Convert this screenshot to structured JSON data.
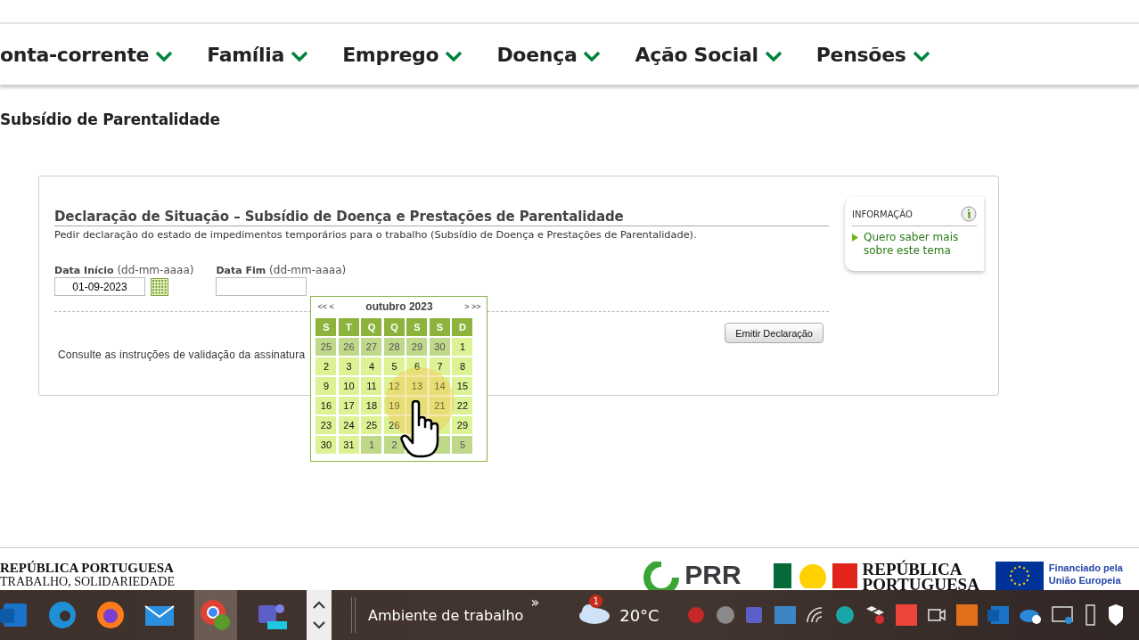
{
  "nav": [
    {
      "label": "onta-corrente"
    },
    {
      "label": "Família"
    },
    {
      "label": "Emprego"
    },
    {
      "label": "Doença"
    },
    {
      "label": "Ação Social"
    },
    {
      "label": "Pensões"
    }
  ],
  "page_title": "Subsídio de Parentalidade",
  "form": {
    "title": "Declaração de Situação – Subsídio de Doença e Prestações de Parentalidade",
    "description": "Pedir declaração do estado de impedimentos temporários para o trabalho (Subsídio de Doença e Prestações de Parentalidade).",
    "start": {
      "label": "Data Início",
      "hint": "(dd-mm-aaaa)",
      "value": "01-09-2023"
    },
    "end": {
      "label": "Data Fim",
      "hint": "(dd-mm-aaaa)"
    },
    "button": "Emitir Declaração",
    "note": "Consulte as instruções de validação da assinatura"
  },
  "info": {
    "title": "INFORMAÇÃO",
    "link": "Quero saber mais sobre este tema"
  },
  "calendar": {
    "prev_year": "<<",
    "prev_month": "<",
    "month": "outubro 2023",
    "next_month": ">",
    "next_year": ">>",
    "weekdays": [
      "S",
      "T",
      "Q",
      "Q",
      "S",
      "S",
      "D"
    ],
    "days": [
      {
        "day": "25",
        "muted": true
      },
      {
        "day": "26",
        "muted": true
      },
      {
        "day": "27",
        "muted": true
      },
      {
        "day": "28",
        "muted": true
      },
      {
        "day": "29",
        "muted": true
      },
      {
        "day": "30",
        "muted": true
      },
      {
        "day": "1",
        "muted": false
      },
      {
        "day": "2",
        "muted": false
      },
      {
        "day": "3",
        "muted": false
      },
      {
        "day": "4",
        "muted": false
      },
      {
        "day": "5",
        "muted": false
      },
      {
        "day": "6",
        "muted": false
      },
      {
        "day": "7",
        "muted": false
      },
      {
        "day": "8",
        "muted": false
      },
      {
        "day": "9",
        "muted": false
      },
      {
        "day": "10",
        "muted": false
      },
      {
        "day": "11",
        "muted": false
      },
      {
        "day": "12",
        "muted": false
      },
      {
        "day": "13",
        "muted": false
      },
      {
        "day": "14",
        "muted": false
      },
      {
        "day": "15",
        "muted": false
      },
      {
        "day": "16",
        "muted": false
      },
      {
        "day": "17",
        "muted": false
      },
      {
        "day": "18",
        "muted": false
      },
      {
        "day": "19",
        "muted": false
      },
      {
        "muted": false
      },
      {
        "day": "21",
        "muted": false
      },
      {
        "day": "22",
        "muted": false
      },
      {
        "day": "23",
        "muted": false
      },
      {
        "day": "24",
        "muted": false
      },
      {
        "day": "25",
        "muted": false
      },
      {
        "day": "26",
        "muted": false
      },
      {
        "muted": false
      },
      {
        "muted": false
      },
      {
        "day": "29",
        "muted": false
      },
      {
        "day": "30",
        "muted": false
      },
      {
        "day": "31",
        "muted": false
      },
      {
        "day": "1",
        "muted": true
      },
      {
        "day": "2",
        "muted": true
      },
      {
        "muted": true
      },
      {
        "muted": true
      },
      {
        "day": "5",
        "muted": true
      }
    ]
  },
  "footer": {
    "left_title": "REPÚBLICA PORTUGUESA",
    "left_sub": "TRABALHO, SOLIDARIEDADE",
    "prr": "PRR",
    "rep_line1": "REPÚBLICA",
    "rep_line2": "PORTUGUESA",
    "eu_line1": "Financiado pela",
    "eu_line2": "União Europeia"
  },
  "taskbar": {
    "desktop": "Ambiente de trabalho",
    "more": "»",
    "weather_badge": "1",
    "temperature": "20°C"
  }
}
